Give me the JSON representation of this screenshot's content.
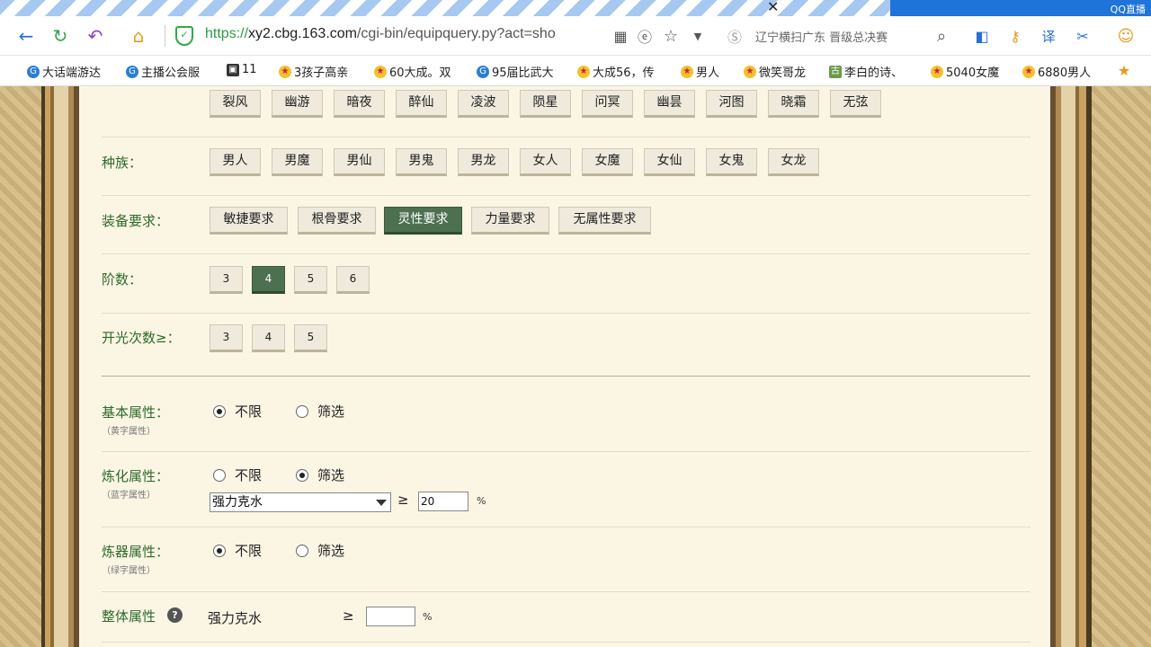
{
  "browser": {
    "tab_right_label": "QQ直播",
    "url_scheme": "https://",
    "url_host": "xy2.cbg.163.com",
    "url_path": "/cgi-bin/equipquery.py?act=sho",
    "search_hint": "辽宁横扫广东 晋级总决赛",
    "bookmarks": [
      "大话端游达",
      "主播公会服",
      "11",
      "3孩子高亲",
      "60大成。双",
      "95届比武大",
      "大成56，传",
      "男人",
      "微笑哥龙",
      "李白的诗、",
      "5040女魔",
      "6880男人"
    ],
    "bookmark_icon_text": [
      "G",
      "G",
      "▣",
      "★",
      "★",
      "G",
      "★",
      "★",
      "★",
      "古",
      "★",
      "★"
    ]
  },
  "form": {
    "top_row": [
      "裂风",
      "幽游",
      "暗夜",
      "醉仙",
      "凌波",
      "陨星",
      "问冥",
      "幽昙",
      "河图",
      "晓霜",
      "无弦"
    ],
    "race": {
      "label": "种族：",
      "options": [
        "男人",
        "男魔",
        "男仙",
        "男鬼",
        "男龙",
        "女人",
        "女魔",
        "女仙",
        "女鬼",
        "女龙"
      ]
    },
    "equip_req": {
      "label": "装备要求：",
      "options": [
        "敏捷要求",
        "根骨要求",
        "灵性要求",
        "力量要求",
        "无属性要求"
      ],
      "selected": "灵性要求"
    },
    "tier": {
      "label": "阶数：",
      "options": [
        "3",
        "4",
        "5",
        "6"
      ],
      "selected": "4"
    },
    "open_count": {
      "label": "开光次数≥：",
      "options": [
        "3",
        "4",
        "5"
      ]
    },
    "basic_attr": {
      "label": "基本属性：",
      "sub": "（黄字属性）",
      "opt_unlimited": "不限",
      "opt_filter": "筛选",
      "selected": "不限"
    },
    "refine_attr": {
      "label": "炼化属性：",
      "sub": "（蓝字属性）",
      "opt_unlimited": "不限",
      "opt_filter": "筛选",
      "selected": "筛选",
      "select_value": "强力克水",
      "ge": "≥",
      "value": "20",
      "unit": "%"
    },
    "forge_attr": {
      "label": "炼器属性：",
      "sub": "（绿字属性）",
      "opt_unlimited": "不限",
      "opt_filter": "筛选",
      "selected": "不限"
    },
    "overall_attr": {
      "label": "整体属性",
      "help": "?",
      "name": "强力克水",
      "ge": "≥",
      "value": "",
      "unit": "%"
    }
  }
}
